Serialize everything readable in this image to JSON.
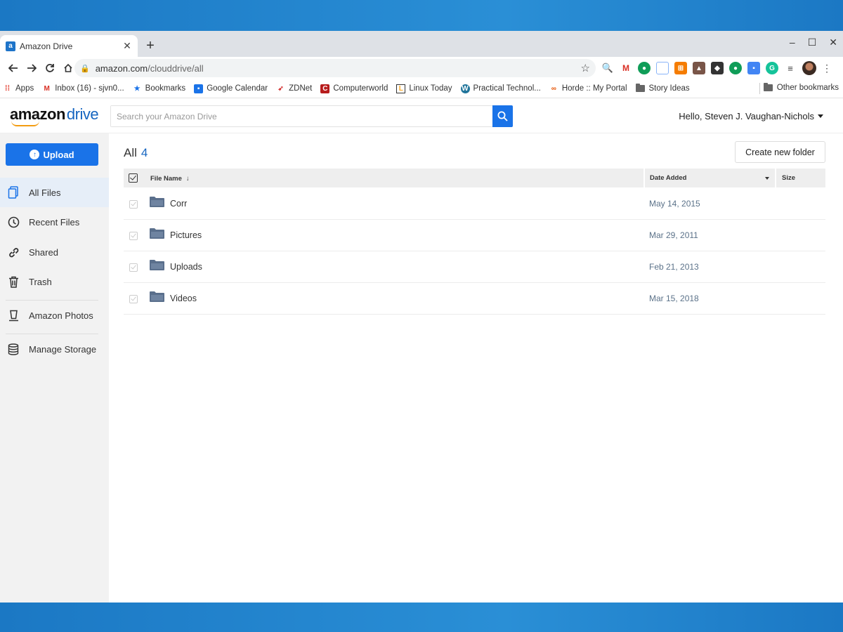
{
  "browser": {
    "tab_title": "Amazon Drive",
    "tab_favicon_letter": "a",
    "url_host": "amazon.com",
    "url_path": "/clouddrive/all",
    "bookmarks": [
      {
        "label": "Apps",
        "icon": "apps-grid-icon",
        "color": "#e34133"
      },
      {
        "label": "Inbox (16) - sjvn0...",
        "icon": "gmail-icon",
        "color": "#d93025"
      },
      {
        "label": "Bookmarks",
        "icon": "star-icon",
        "color": "#1a73e8"
      },
      {
        "label": "Google Calendar",
        "icon": "calendar-icon",
        "color": "#1a73e8"
      },
      {
        "label": "ZDNet",
        "icon": "zdnet-icon",
        "color": "#d32f2f"
      },
      {
        "label": "Computerworld",
        "icon": "computerworld-icon",
        "color": "#b71c1c"
      },
      {
        "label": "Linux Today",
        "icon": "linux-today-icon",
        "color": "#f9a825"
      },
      {
        "label": "Practical Technol...",
        "icon": "wordpress-icon",
        "color": "#21759b"
      },
      {
        "label": "Horde :: My Portal",
        "icon": "horde-icon",
        "color": "#e65100"
      },
      {
        "label": "Story Ideas",
        "icon": "folder-icon",
        "color": "#666666"
      }
    ],
    "other_bookmarks": "Other bookmarks"
  },
  "app": {
    "logo_amazon": "amazon",
    "logo_drive": "drive",
    "search_placeholder": "Search your Amazon Drive",
    "greeting": "Hello, Steven J. Vaughan-Nichols",
    "upload_label": "Upload",
    "nav": [
      {
        "label": "All Files",
        "icon": "files-icon",
        "active": true
      },
      {
        "label": "Recent Files",
        "icon": "clock-icon",
        "active": false
      },
      {
        "label": "Shared",
        "icon": "link-icon",
        "active": false
      },
      {
        "label": "Trash",
        "icon": "trash-icon",
        "active": false
      },
      {
        "label": "Amazon Photos",
        "icon": "photos-icon",
        "active": false
      },
      {
        "label": "Manage Storage",
        "icon": "storage-icon",
        "active": false
      }
    ],
    "title": "All",
    "count": "4",
    "create_folder_label": "Create new folder",
    "columns": {
      "name": "File Name",
      "name_sort": "↓",
      "date": "Date Added",
      "size": "Size"
    },
    "files": [
      {
        "name": "Corr",
        "date": "May 14, 2015"
      },
      {
        "name": "Pictures",
        "date": "Mar 29, 2011"
      },
      {
        "name": "Uploads",
        "date": "Feb 21, 2013"
      },
      {
        "name": "Videos",
        "date": "Mar 15, 2018"
      }
    ],
    "colors": {
      "accent": "#1a73e8",
      "folder": "#5a6f8c",
      "date_text": "#5b7289"
    }
  }
}
